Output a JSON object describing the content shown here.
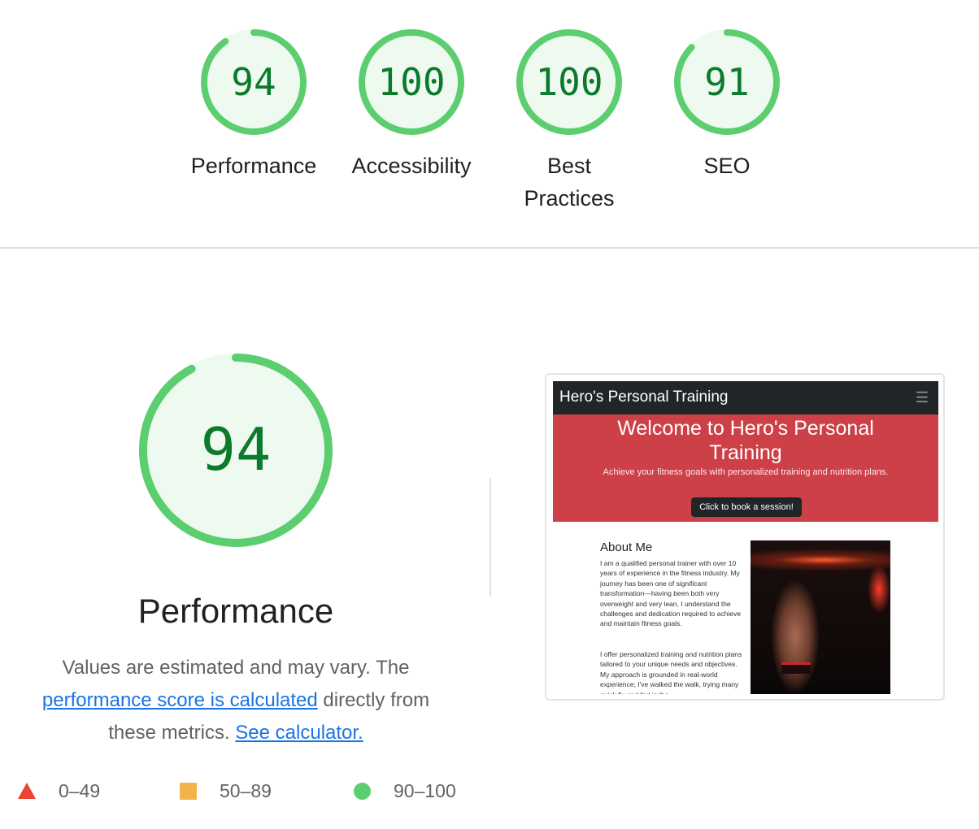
{
  "summary": {
    "categories": [
      {
        "label": "Performance",
        "score": "94",
        "fraction": 0.94
      },
      {
        "label": "Accessibility",
        "score": "100",
        "fraction": 1.0
      },
      {
        "label": "Best Practices",
        "score": "100",
        "fraction": 1.0
      },
      {
        "label": "SEO",
        "score": "91",
        "fraction": 0.91
      }
    ]
  },
  "performance": {
    "score": "94",
    "fraction": 0.94,
    "title": "Performance",
    "desc_prefix": "Values are estimated and may vary. The ",
    "desc_link1": "performance score is calculated",
    "desc_middle": " directly from these metrics. ",
    "desc_link2": "See calculator."
  },
  "legend": [
    {
      "range": "0–49",
      "shape": "triangle",
      "color": "#eb4335"
    },
    {
      "range": "50–89",
      "shape": "square",
      "color": "#f4b24a"
    },
    {
      "range": "90–100",
      "shape": "circle",
      "color": "#5cce6f"
    }
  ],
  "colors": {
    "pass_ring": "#5cce6f",
    "pass_fill": "#eefaf0",
    "pass_text": "#0c7a2b",
    "link": "#1a73e8"
  },
  "screenshot": {
    "brand": "Hero's Personal Training",
    "menu_icon": "hamburger-icon",
    "hero_title": "Welcome to Hero's Personal Training",
    "hero_subtitle": "Achieve your fitness goals with personalized training and nutrition plans.",
    "hero_button": "Click to book a session!",
    "about_title": "About Me",
    "about_p1": "I am a qualified personal trainer with over 10 years of experience in the fitness industry. My journey has been one of significant transformation—having been both very overweight and very lean, I understand the challenges and dedication required to achieve and maintain fitness goals.",
    "about_p2": "I offer personalized training and nutrition plans tailored to your unique needs and objectives. My approach is grounded in real-world experience; I've walked the walk, trying many quick fix and fad in the"
  }
}
